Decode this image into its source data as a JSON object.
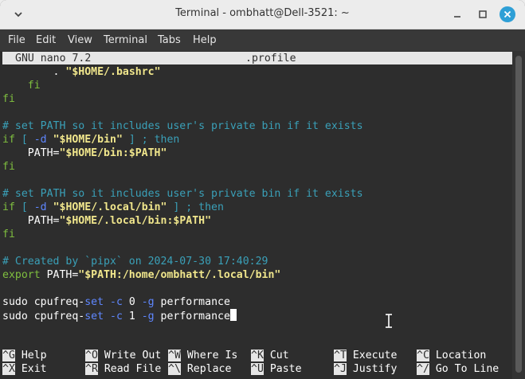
{
  "window": {
    "title": "Terminal - ombhatt@Dell-3521: ~"
  },
  "menubar": {
    "items": [
      "File",
      "Edit",
      "View",
      "Terminal",
      "Tabs",
      "Help"
    ]
  },
  "nano": {
    "version": "GNU nano 7.2",
    "filename": ".profile"
  },
  "lines": [
    {
      "indent": "        ",
      "parts": [
        [
          "white",
          ". "
        ],
        [
          "yellow",
          "\"$HOME/.bashrc\""
        ]
      ]
    },
    {
      "indent": "    ",
      "parts": [
        [
          "green",
          "fi"
        ]
      ]
    },
    {
      "indent": "",
      "parts": [
        [
          "green",
          "fi"
        ]
      ]
    },
    {
      "indent": "",
      "parts": []
    },
    {
      "indent": "",
      "parts": [
        [
          "cyan",
          "# set PATH so it includes user's private bin if it exists"
        ]
      ]
    },
    {
      "indent": "",
      "parts": [
        [
          "green",
          "if"
        ],
        [
          "cyan",
          " [ "
        ],
        [
          "blue",
          "-d"
        ],
        [
          "white",
          " "
        ],
        [
          "yellow",
          "\"$HOME/bin\""
        ],
        [
          "cyan",
          " ] ; then"
        ]
      ]
    },
    {
      "indent": "    ",
      "parts": [
        [
          "white",
          "PATH="
        ],
        [
          "yellow",
          "\"$HOME/bin:$PATH\""
        ]
      ]
    },
    {
      "indent": "",
      "parts": [
        [
          "green",
          "fi"
        ]
      ]
    },
    {
      "indent": "",
      "parts": []
    },
    {
      "indent": "",
      "parts": [
        [
          "cyan",
          "# set PATH so it includes user's private bin if it exists"
        ]
      ]
    },
    {
      "indent": "",
      "parts": [
        [
          "green",
          "if"
        ],
        [
          "cyan",
          " [ "
        ],
        [
          "blue",
          "-d"
        ],
        [
          "white",
          " "
        ],
        [
          "yellow",
          "\"$HOME/.local/bin\""
        ],
        [
          "cyan",
          " ] ; then"
        ]
      ]
    },
    {
      "indent": "    ",
      "parts": [
        [
          "white",
          "PATH="
        ],
        [
          "yellow",
          "\"$HOME/.local/bin:$PATH\""
        ]
      ]
    },
    {
      "indent": "",
      "parts": [
        [
          "green",
          "fi"
        ]
      ]
    },
    {
      "indent": "",
      "parts": []
    },
    {
      "indent": "",
      "parts": [
        [
          "cyan",
          "# Created by `pipx` on 2024-07-30 17:40:29"
        ]
      ]
    },
    {
      "indent": "",
      "parts": [
        [
          "green",
          "export"
        ],
        [
          "white",
          " PATH="
        ],
        [
          "yellow",
          "\"$PATH:/home/ombhatt/.local/bin\""
        ]
      ]
    },
    {
      "indent": "",
      "parts": []
    },
    {
      "indent": "",
      "parts": [
        [
          "white",
          "sudo cpufreq-"
        ],
        [
          "blue",
          "set"
        ],
        [
          "white",
          " "
        ],
        [
          "blue",
          "-c"
        ],
        [
          "white",
          " 0 "
        ],
        [
          "blue",
          "-g"
        ],
        [
          "white",
          " performance"
        ]
      ]
    },
    {
      "indent": "",
      "parts": [
        [
          "white",
          "sudo cpufreq-"
        ],
        [
          "blue",
          "set"
        ],
        [
          "white",
          " "
        ],
        [
          "blue",
          "-c"
        ],
        [
          "white",
          " 1 "
        ],
        [
          "blue",
          "-g"
        ],
        [
          "white",
          " performance"
        ]
      ]
    }
  ],
  "help": {
    "row1": [
      {
        "key": "^G",
        "label": "Help"
      },
      {
        "key": "^O",
        "label": "Write Out"
      },
      {
        "key": "^W",
        "label": "Where Is"
      },
      {
        "key": "^K",
        "label": "Cut"
      },
      {
        "key": "^T",
        "label": "Execute"
      },
      {
        "key": "^C",
        "label": "Location"
      }
    ],
    "row2": [
      {
        "key": "^X",
        "label": "Exit"
      },
      {
        "key": "^R",
        "label": "Read File"
      },
      {
        "key": "^\\",
        "label": "Replace"
      },
      {
        "key": "^U",
        "label": "Paste"
      },
      {
        "key": "^J",
        "label": "Justify"
      },
      {
        "key": "^/",
        "label": "Go To Line"
      }
    ]
  },
  "icons": {
    "window_menu": "chevron-down-icon",
    "minimize": "minimize-icon",
    "maximize": "maximize-icon",
    "close": "close-icon",
    "mouse": "ibeam-cursor-icon"
  },
  "colors": {
    "close_button": "#2e9fd6",
    "terminal_bg": "#2d2d2d"
  }
}
